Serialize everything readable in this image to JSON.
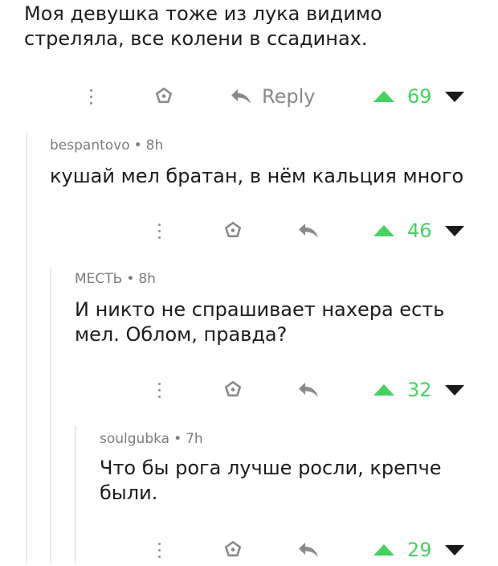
{
  "top_comment": {
    "text": "Моя девушка тоже из лука видимо\nстреляла, все колени в ссадинах.",
    "reply_label": "Reply",
    "score": "69"
  },
  "replies": [
    {
      "author": "bespantovo",
      "separator": "•",
      "age": "8h",
      "text": "кушай мел братан, в нём кальция много",
      "score": "46"
    },
    {
      "author": "МЕСТЬ",
      "separator": "•",
      "age": "8h",
      "text": "И никто не спрашивает нахера есть\nмел. Облом, правда?",
      "score": "32"
    },
    {
      "author": "soulgubka",
      "separator": "•",
      "age": "7h",
      "text": "Что бы рога лучше росли, крепче\nбыли.",
      "score": "29"
    }
  ],
  "icons": {
    "more": "more-vertical-icon",
    "award": "award-icon",
    "reply": "reply-arrow-icon",
    "upvote": "upvote-icon",
    "downvote": "downvote-icon"
  },
  "colors": {
    "upvote_green": "#46d160",
    "meta_gray": "#7c7c7c",
    "thread_line": "#e9e9ea"
  }
}
